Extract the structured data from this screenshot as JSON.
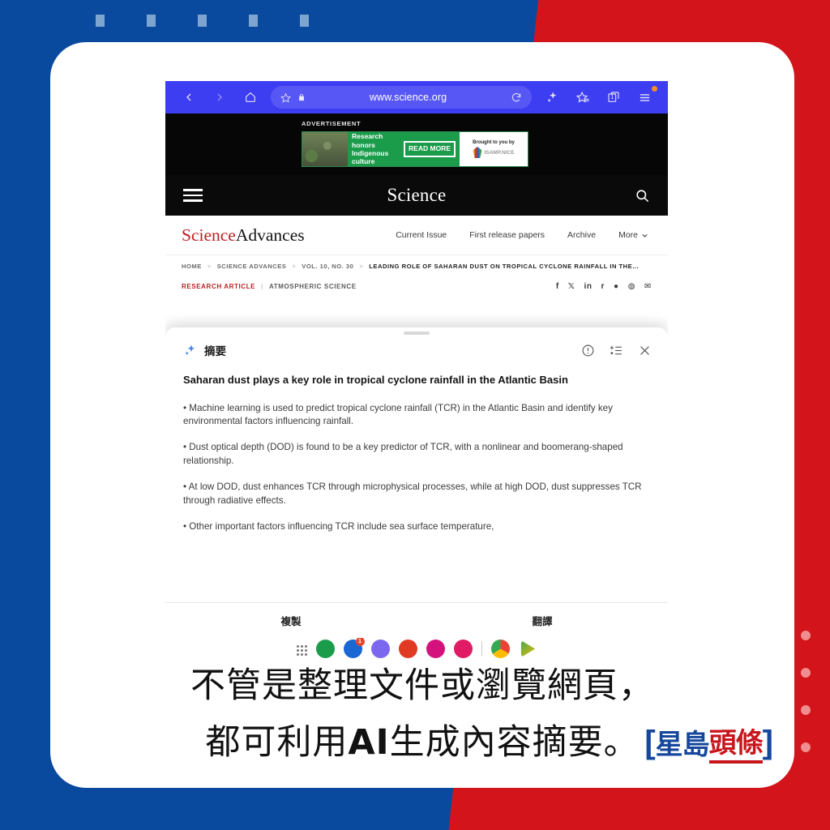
{
  "background": {
    "blue": "#0a4a9e",
    "red": "#d3141a",
    "dash_count": 5,
    "dot_count": 4
  },
  "browser": {
    "url": "www.science.org",
    "icons": {
      "back": "back-arrow-icon",
      "forward": "forward-arrow-icon",
      "home": "home-icon",
      "bookmark": "star-icon",
      "lock": "lock-icon",
      "reload": "reload-icon",
      "ai": "ai-sparkle-icon",
      "collections": "star-list-icon",
      "tabs": "tab-switcher-icon",
      "menu": "hamburger-menu-icon"
    },
    "tab_count": "1"
  },
  "ad": {
    "label": "ADVERTISEMENT",
    "headline": "Research honors Indigenous culture",
    "cta": "READ MORE",
    "brought": "Brought to you by",
    "sponsor": "ISAMP",
    "sponsor_suffix": ".NICE"
  },
  "site": {
    "masthead": "Science",
    "journal_primary": "Science",
    "journal_secondary": "Advances",
    "nav": [
      "Current Issue",
      "First release papers",
      "Archive"
    ],
    "more_label": "More"
  },
  "breadcrumb": {
    "items": [
      "HOME",
      "SCIENCE ADVANCES",
      "VOL. 10, NO. 30"
    ],
    "current": "LEADING ROLE OF SAHARAN DUST ON TROPICAL CYCLONE RAINFALL IN THE…"
  },
  "article_head": {
    "type": "RESEARCH ARTICLE",
    "subject": "ATMOSPHERIC SCIENCE"
  },
  "summary_panel": {
    "title": "摘要",
    "ai_icon": "ai-sparkle-icon",
    "actions": {
      "info": "info-circle-icon",
      "format": "list-format-icon",
      "close": "close-icon"
    },
    "headline": "Saharan dust plays a key role in tropical cyclone rainfall in the Atlantic Basin",
    "bullets": [
      "• Machine learning is used to predict tropical cyclone rainfall (TCR) in the Atlantic Basin and identify key environmental factors influencing rainfall.",
      "• Dust optical depth (DOD) is found to be a key predictor of TCR, with a nonlinear and boomerang-shaped relationship.",
      "• At low DOD, dust enhances TCR through microphysical processes, while at high DOD, dust suppresses TCR through radiative effects.",
      "• Other important factors influencing TCR include sea surface temperature,"
    ],
    "buttons": {
      "copy": "複製",
      "translate": "翻譯"
    }
  },
  "dock": {
    "apps_grid_icon": "app-drawer-icon",
    "items": [
      {
        "name": "dock-app-green",
        "color": "#1a9c4b"
      },
      {
        "name": "dock-app-blue",
        "color": "#1967d2",
        "badge": "1"
      },
      {
        "name": "dock-app-purple",
        "color": "#7b68ee"
      },
      {
        "name": "dock-app-red",
        "color": "#e03a23"
      },
      {
        "name": "dock-app-magenta",
        "color": "#d4127e"
      },
      {
        "name": "dock-app-pink",
        "color": "#e01b64"
      },
      {
        "name": "dock-app-chrome",
        "color": "#f5b400"
      },
      {
        "name": "dock-app-play-store",
        "color": "#34a853"
      }
    ]
  },
  "caption": {
    "line1": "不管是整理文件或瀏覽網頁，",
    "line2_a": "都可利用",
    "line2_b": "AI",
    "line2_c": "生成內容摘要。"
  },
  "watermark": {
    "left_bracket": "[",
    "blue": "星島",
    "red": "頭條",
    "right_bracket": "]"
  }
}
